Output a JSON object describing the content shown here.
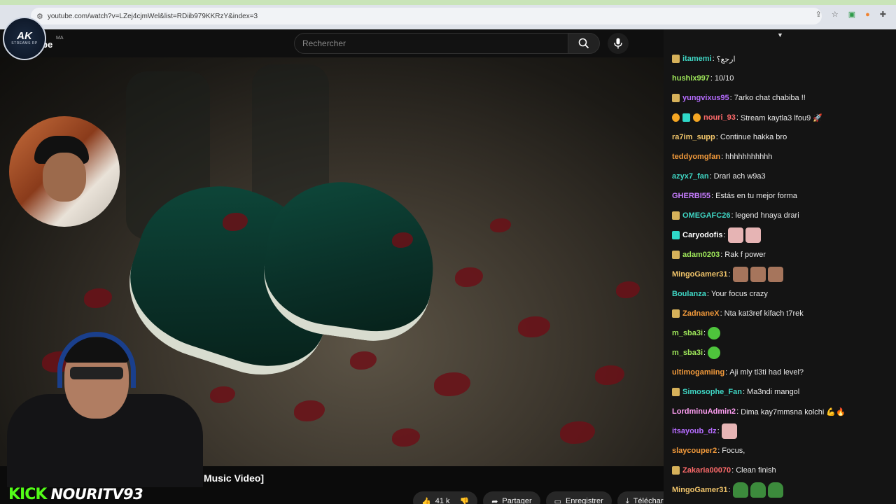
{
  "browser": {
    "url": "youtube.com/watch?v=LZej4cjmWel&list=RDiib979KKRzY&index=3"
  },
  "youtube": {
    "logo_text": "be",
    "region": "MA",
    "search_placeholder": "Rechercher",
    "video_title": "Music Video]",
    "actions": {
      "likes": "41 k",
      "share": "Partager",
      "save": "Enregistrer",
      "download": "Télécharg"
    }
  },
  "overlay": {
    "channel_logo_main": "AK",
    "channel_logo_sub": "STREAMS RP",
    "kick_word": "KICK",
    "kick_user": "NOURITV93"
  },
  "chat": {
    "messages": [
      {
        "user": "itamemi",
        "color": "#3fd6c4",
        "badges": [
          "gold"
        ],
        "text": "ارجع؟",
        "emotes": []
      },
      {
        "user": "hushix997",
        "color": "#9ee65a",
        "badges": [],
        "text": "10/10",
        "emotes": []
      },
      {
        "user": "yungvixus95",
        "color": "#b56cff",
        "badges": [
          "gold"
        ],
        "text": "7arko chat chabiba !!",
        "emotes": []
      },
      {
        "user": "nouri_93",
        "color": "#ff6b6b",
        "badges": [
          "orange",
          "teal",
          "orange"
        ],
        "text": "Stream kaytla3 lfou9 🚀",
        "emotes": []
      },
      {
        "user": "ra7im_supp",
        "color": "#f0c46a",
        "badges": [],
        "text": "Continue hakka bro",
        "emotes": []
      },
      {
        "user": "teddyomgfan",
        "color": "#f29a3b",
        "badges": [],
        "text": "hhhhhhhhhhh",
        "emotes": []
      },
      {
        "user": "azyx7_fan",
        "color": "#3fd6c4",
        "badges": [],
        "text": "Drari ach w9a3",
        "emotes": []
      },
      {
        "user": "GHERBI55",
        "color": "#c77dff",
        "badges": [],
        "text": "Estás en tu mejor forma",
        "emotes": []
      },
      {
        "user": "OMEGAFC26",
        "color": "#3fd6c4",
        "badges": [
          "gold"
        ],
        "text": "legend hnaya drari",
        "emotes": []
      },
      {
        "user": "Caryodofis",
        "color": "#ffffff",
        "badges": [
          "teal"
        ],
        "text": "",
        "emotes": [
          "pink",
          "pink"
        ]
      },
      {
        "user": "adam0203",
        "color": "#9ee65a",
        "badges": [
          "gold"
        ],
        "text": "Rak f power",
        "emotes": []
      },
      {
        "user": "MingoGamer31",
        "color": "#f0c46a",
        "badges": [],
        "text": "",
        "emotes": [
          "face",
          "face",
          "face"
        ]
      },
      {
        "user": "Boulanza",
        "color": "#3fd6c4",
        "badges": [],
        "text": "Your focus crazy",
        "emotes": []
      },
      {
        "user": "ZadnaneX",
        "color": "#f29a3b",
        "badges": [
          "gold"
        ],
        "text": "Nta kat3ref kifach t7rek",
        "emotes": []
      },
      {
        "user": "m_sba3i",
        "color": "#9ee65a",
        "badges": [],
        "text": "",
        "emotes": [
          "green"
        ]
      },
      {
        "user": "m_sba3i",
        "color": "#9ee65a",
        "badges": [],
        "text": "",
        "emotes": [
          "green"
        ]
      },
      {
        "user": "ultimogamiing",
        "color": "#f29a3b",
        "badges": [],
        "text": "Aji mly tl3ti had level?",
        "emotes": []
      },
      {
        "user": "Simosophe_Fan",
        "color": "#3fd6c4",
        "badges": [
          "gold"
        ],
        "text": "Ma3ndi mangol",
        "emotes": []
      },
      {
        "user": "LordminuAdmin2",
        "color": "#ff9ff3",
        "badges": [],
        "text": "Dima kay7mmsna kolchi 💪🔥",
        "emotes": []
      },
      {
        "user": "itsayoub_dz",
        "color": "#b56cff",
        "badges": [],
        "text": "",
        "emotes": [
          "pink"
        ]
      },
      {
        "user": "slaycouper2",
        "color": "#f29a3b",
        "badges": [],
        "text": "Focus,",
        "emotes": []
      },
      {
        "user": "Zakaria00070",
        "color": "#ff6b6b",
        "badges": [
          "gold"
        ],
        "text": "Clean finish",
        "emotes": []
      },
      {
        "user": "MingoGamer31",
        "color": "#f0c46a",
        "badges": [],
        "text": "",
        "emotes": [
          "frog",
          "frog",
          "frog"
        ]
      }
    ]
  }
}
